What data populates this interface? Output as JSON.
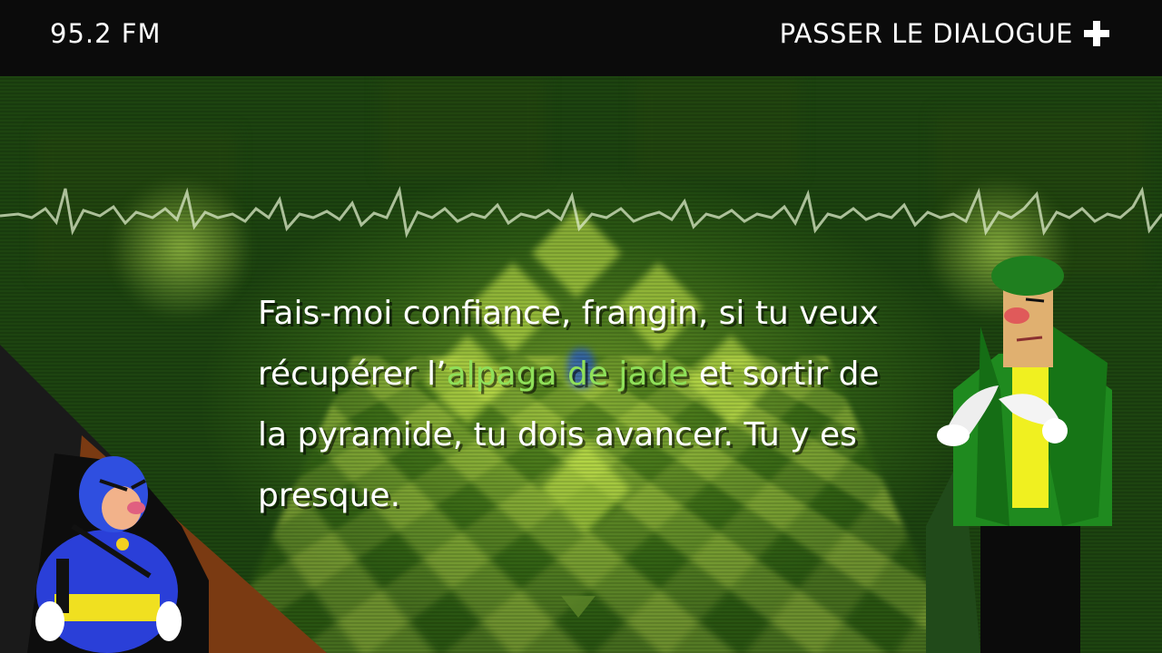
{
  "hud": {
    "station": "95.2 FM",
    "skip_label": "PASSER LE DIALOGUE",
    "skip_icon": "plus-icon"
  },
  "dialogue": {
    "before": "Fais-moi confiance, frangin, si tu veux récupérer l’",
    "highlight": "alpaga de jade",
    "after": " et sortir de la pyramide, tu dois avancer. Tu y es presque.",
    "highlight_color": "#8fe05a",
    "text_color": "#ffffff",
    "next_icon": "triangle-down-icon"
  },
  "characters": {
    "left": "masked-brother-avatar",
    "right": "green-coat-speaker-avatar"
  },
  "colors": {
    "topbar": "#0b0b0b",
    "scene_green": "#4d7a1e",
    "waveform": "#d8e8c0"
  }
}
